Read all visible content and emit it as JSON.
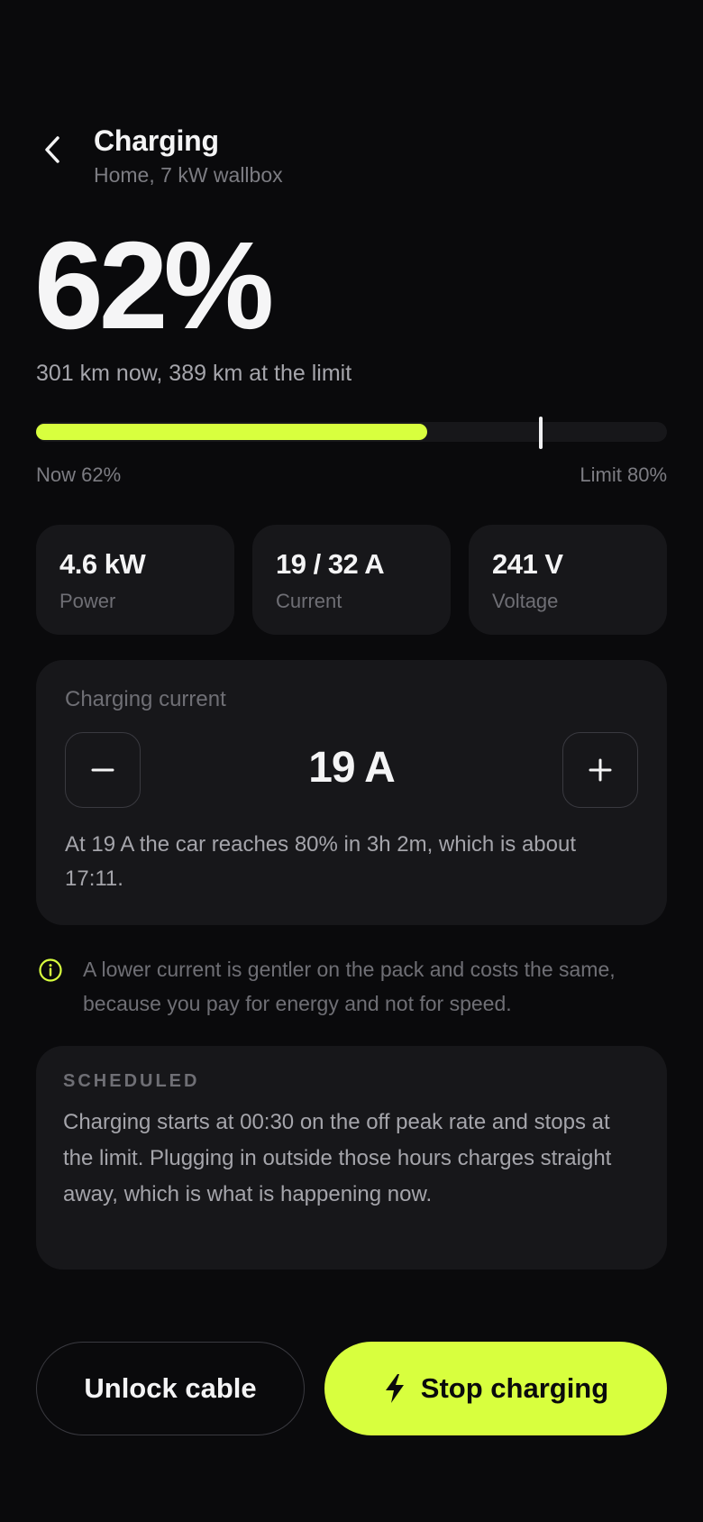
{
  "header": {
    "title": "Charging",
    "subtitle": "Home, 7 kW wallbox"
  },
  "battery": {
    "percent_text": "62%",
    "range_text": "301 km now, 389 km at the limit",
    "level_fraction": 0.62,
    "limit_fraction": 0.8,
    "now_label": "Now 62%",
    "limit_label": "Limit 80%"
  },
  "stats": [
    {
      "value": "4.6 kW",
      "label": "Power"
    },
    {
      "value": "19 / 32 A",
      "label": "Current"
    },
    {
      "value": "241 V",
      "label": "Voltage"
    }
  ],
  "current_card": {
    "label": "Charging current",
    "value": "19 A",
    "minus_symbol": "−",
    "plus_symbol": "+",
    "note": "At 19 A the car reaches 80% in 3h 2m, which is about 17:11."
  },
  "tip": {
    "icon": "info-icon",
    "text": "A lower current is gentler on the pack and costs the same, because you pay for energy and not for speed."
  },
  "scheduled": {
    "title": "SCHEDULED",
    "text": "Charging starts at 00:30 on the off peak rate and stops at the limit. Plugging in outside those hours charges straight away, which is what is happening now."
  },
  "actions": {
    "unlock_label": "Unlock cable",
    "stop_label": "Stop charging",
    "stop_icon": "lightning-icon"
  },
  "colors": {
    "background": "#0a0a0c",
    "card": "#17171a",
    "accent": "#d8ff3e",
    "text_primary": "#f4f4f5",
    "text_secondary": "#a5a5ab",
    "text_muted": "#6f6f75"
  }
}
